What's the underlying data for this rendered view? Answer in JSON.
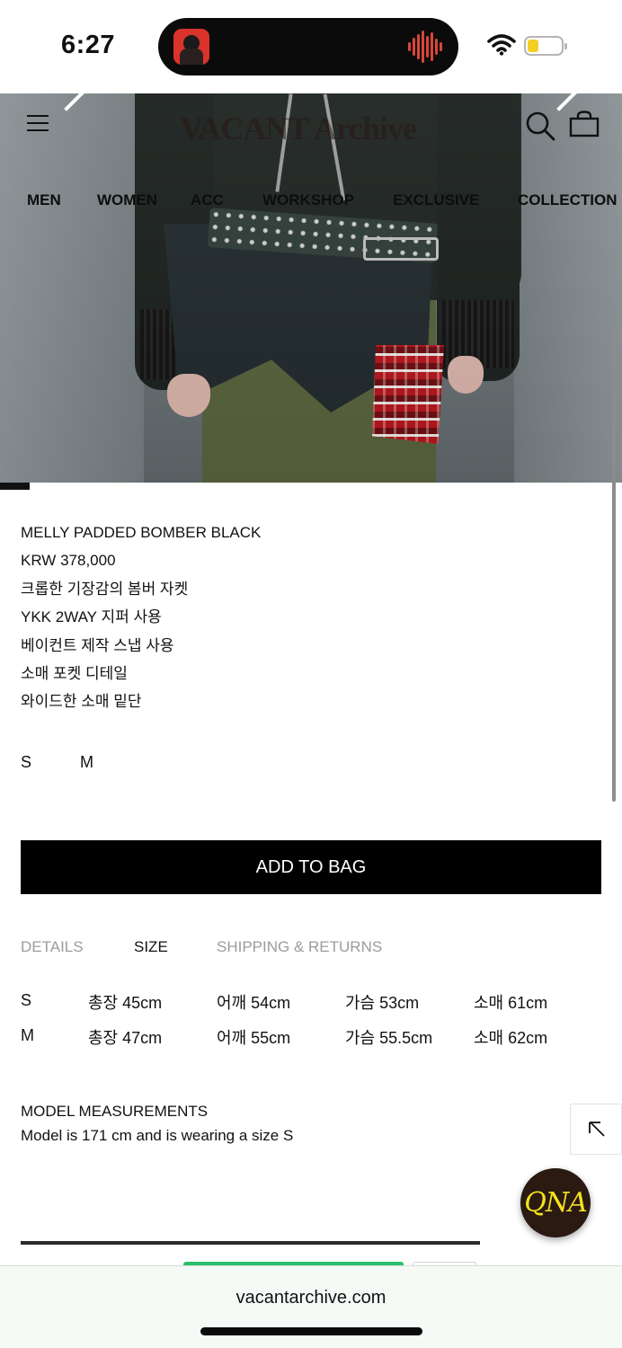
{
  "status_bar": {
    "time": "6:27"
  },
  "header": {
    "logo": "VACANT Archive",
    "nav": [
      "MEN",
      "WOMEN",
      "ACC",
      "WORKSHOP",
      "EXCLUSIVE",
      "COLLECTION"
    ]
  },
  "product": {
    "name": "MELLY PADDED BOMBER BLACK",
    "price": "KRW 378,000",
    "description": [
      "크롭한 기장감의 봄버 자켓",
      "YKK 2WAY 지퍼 사용",
      "베이컨트 제작 스냅 사용",
      "소매 포켓 디테일",
      "와이드한 소매 밑단"
    ],
    "sizes": [
      "S",
      "M"
    ],
    "add_to_bag": "ADD TO BAG"
  },
  "tabs": [
    {
      "label": "DETAILS",
      "active": false
    },
    {
      "label": "SIZE",
      "active": true
    },
    {
      "label": "SHIPPING & RETURNS",
      "active": false
    }
  ],
  "size_chart": [
    {
      "size": "S",
      "length": "총장 45cm",
      "shoulder": "어깨 54cm",
      "chest": "가슴 53cm",
      "sleeve": "소매 61cm"
    },
    {
      "size": "M",
      "length": "총장 47cm",
      "shoulder": "어깨 55cm",
      "chest": "가슴 55.5cm",
      "sleeve": "소매 62cm"
    }
  ],
  "model": {
    "heading": "MODEL MEASUREMENTS",
    "text": "Model is 171 cm and is wearing a size S"
  },
  "qna_label": "QNA",
  "browser": {
    "url": "vacantarchive.com"
  },
  "colors": {
    "accent": "#000000",
    "inactive_tab": "#9c9c9c",
    "qna_text": "#f3e21e",
    "tab_strip": "#28c06a"
  }
}
